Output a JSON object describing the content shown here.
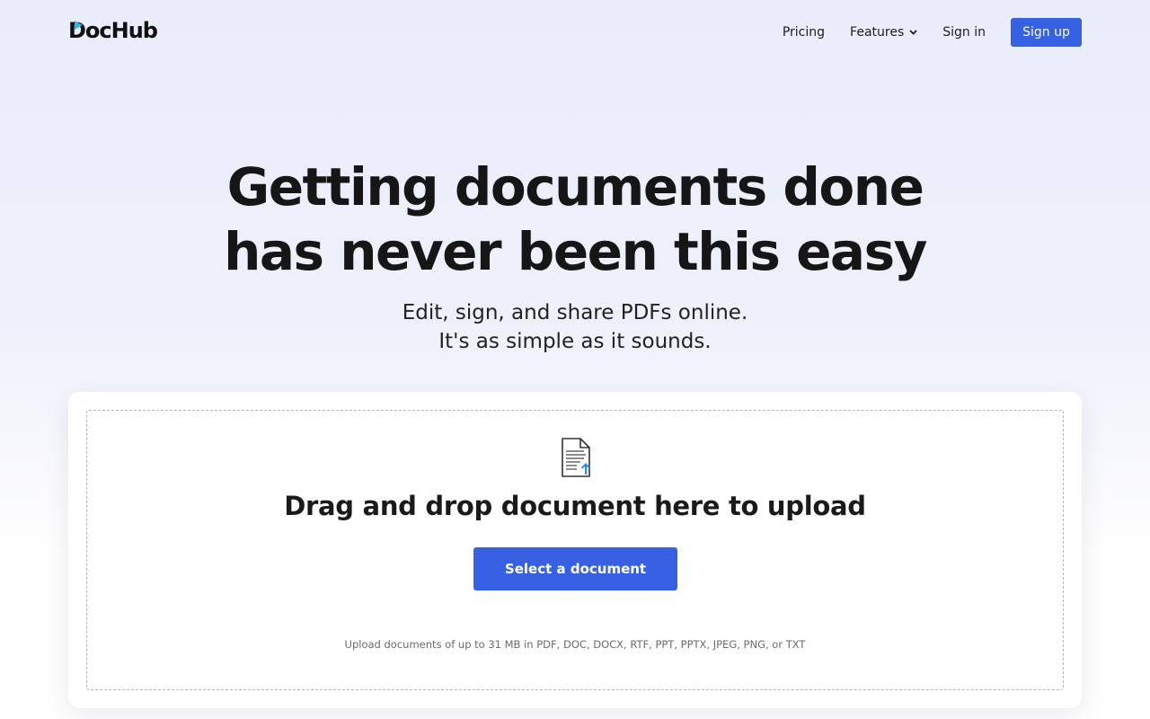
{
  "header": {
    "logo_text": "DocHub",
    "nav": {
      "pricing": "Pricing",
      "features": "Features",
      "sign_in": "Sign in",
      "sign_up": "Sign up"
    }
  },
  "hero": {
    "title_line1": "Getting documents done",
    "title_line2": "has never been this easy",
    "subtitle_line1": "Edit, sign, and share PDFs online.",
    "subtitle_line2": "It's as simple as it sounds."
  },
  "upload": {
    "icon": "document-upload-icon",
    "title": "Drag and drop document here to upload",
    "button_label": "Select a document",
    "hint": "Upload documents of up to 31 MB in PDF, DOC, DOCX, RTF, PPT, PPTX, JPEG, PNG, or TXT"
  },
  "colors": {
    "accent": "#3761e3",
    "upload_arrow": "#2a8ee8",
    "logo_mark": "#2fb3e6"
  }
}
